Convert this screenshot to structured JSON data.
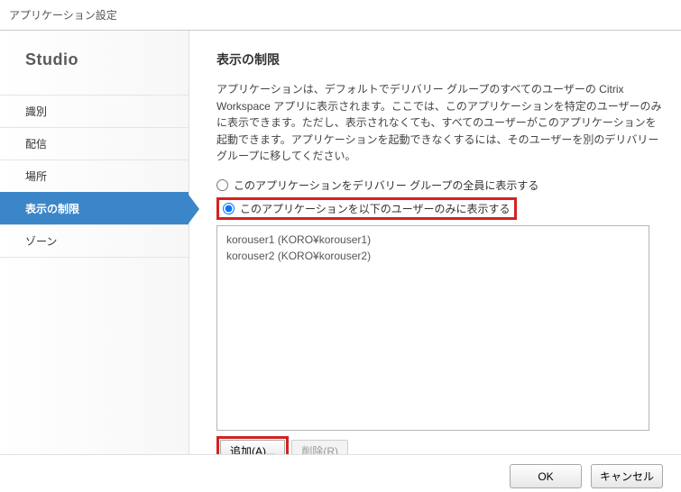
{
  "window": {
    "title": "アプリケーション設定"
  },
  "brand": "Studio",
  "sidebar": {
    "items": [
      {
        "label": "識別"
      },
      {
        "label": "配信"
      },
      {
        "label": "場所"
      },
      {
        "label": "表示の制限"
      },
      {
        "label": "ゾーン"
      }
    ],
    "active_index": 3
  },
  "content": {
    "title": "表示の制限",
    "description": "アプリケーションは、デフォルトでデリバリー グループのすべてのユーザーの Citrix Workspace アプリに表示されます。ここでは、このアプリケーションを特定のユーザーのみに表示できます。ただし、表示されなくても、すべてのユーザーがこのアプリケーションを起動できます。アプリケーションを起動できなくするには、そのユーザーを別のデリバリー グループに移してください。",
    "radio": {
      "option_all": "このアプリケーションをデリバリー グループの全員に表示する",
      "option_limited": "このアプリケーションを以下のユーザーのみに表示する",
      "selected": "limited"
    },
    "users": [
      "korouser1 (KORO¥korouser1)",
      "korouser2 (KORO¥korouser2)"
    ],
    "buttons": {
      "add": "追加(A)...",
      "remove": "削除(R)"
    }
  },
  "footer": {
    "ok": "OK",
    "cancel": "キャンセル"
  }
}
